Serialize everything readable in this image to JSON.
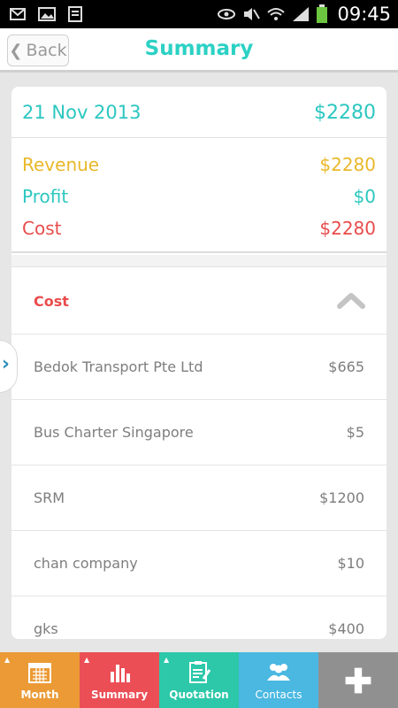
{
  "status_bar": {
    "time": "09:45"
  },
  "header": {
    "back_label": "Back",
    "title": "Summary"
  },
  "summary": {
    "date": "21 Nov 2013",
    "total": "$2280",
    "revenue_label": "Revenue",
    "revenue_value": "$2280",
    "profit_label": "Profit",
    "profit_value": "$0",
    "cost_label": "Cost",
    "cost_value": "$2280"
  },
  "cost_section": {
    "title": "Cost",
    "items": [
      {
        "name": "Bedok Transport Pte Ltd",
        "amount": "$665"
      },
      {
        "name": "Bus Charter Singapore",
        "amount": "$5"
      },
      {
        "name": "SRM",
        "amount": "$1200"
      },
      {
        "name": "chan company",
        "amount": "$10"
      },
      {
        "name": "gks",
        "amount": "$400"
      }
    ]
  },
  "nav": {
    "month": "Month",
    "summary": "Summary",
    "quotation": "Quotation",
    "contacts": "Contacts"
  },
  "colors": {
    "teal": "#2cd1c4",
    "revenue": "#e9b82a",
    "profit": "#2cc7c1",
    "cost": "#e94c4c"
  }
}
